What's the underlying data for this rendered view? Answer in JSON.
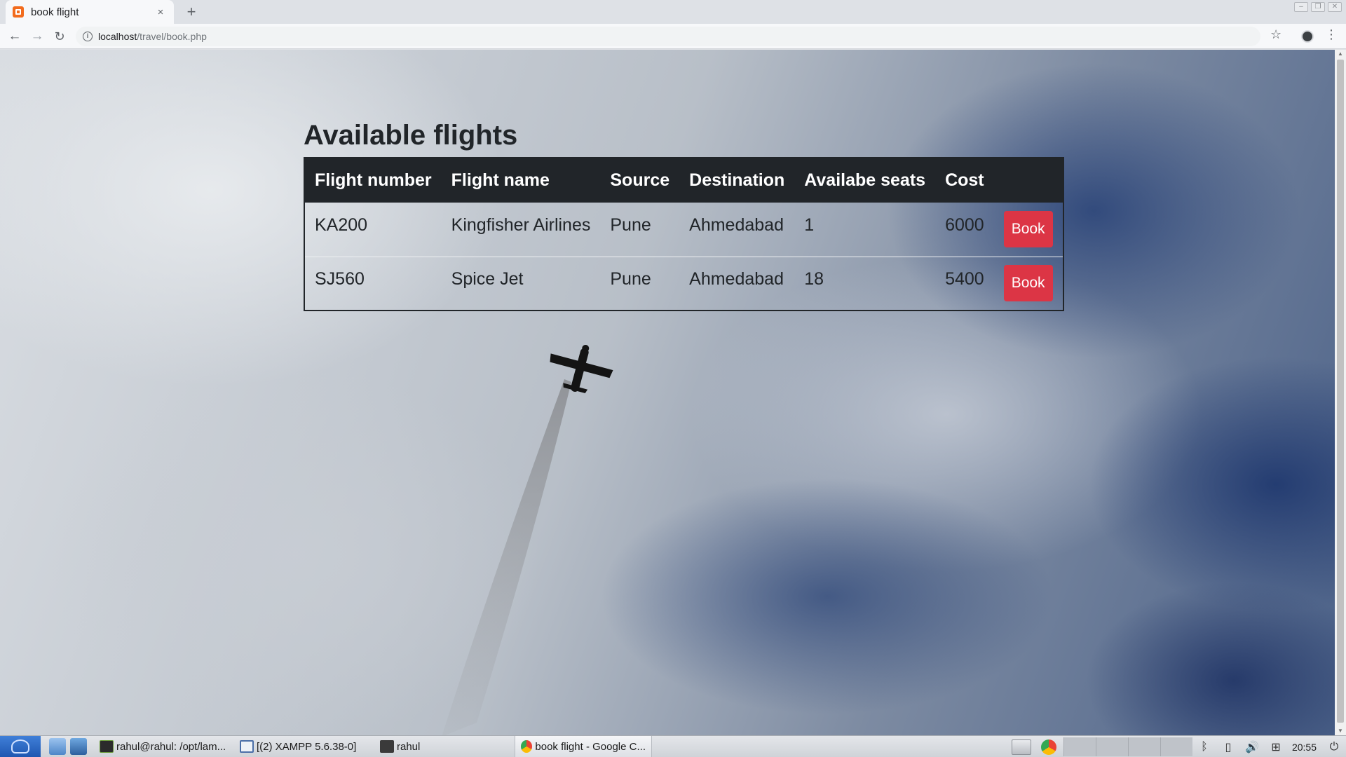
{
  "browser": {
    "tab_title": "book flight",
    "tab_close": "×",
    "new_tab": "+",
    "url_host": "localhost",
    "url_path": "/travel/book.php",
    "icons": [
      "back-icon",
      "forward-icon",
      "reload-icon",
      "info-icon",
      "star-icon",
      "profile-icon",
      "menu-icon"
    ]
  },
  "page": {
    "heading": "Available flights",
    "table": {
      "columns": [
        "Flight number",
        "Flight name",
        "Source",
        "Destination",
        "Availabe seats",
        "Cost"
      ],
      "rows": [
        {
          "flight_number": "KA200",
          "flight_name": "Kingfisher Airlines",
          "source": "Pune",
          "destination": "Ahmedabad",
          "seats": "1",
          "cost": "6000",
          "action": "Book"
        },
        {
          "flight_number": "SJ560",
          "flight_name": "Spice Jet",
          "source": "Pune",
          "destination": "Ahmedabad",
          "seats": "18",
          "cost": "5400",
          "action": "Book"
        }
      ]
    },
    "colors": {
      "header_bg": "#212529",
      "book_button": "#dc3545"
    }
  },
  "taskbar": {
    "items": [
      {
        "label": "rahul@rahul: /opt/lam...",
        "icon": "terminal-icon"
      },
      {
        "label": "[(2) XAMPP 5.6.38-0]",
        "icon": "window-icon"
      },
      {
        "label": "rahul",
        "icon": "folder-icon"
      },
      {
        "label": "book flight - Google C...",
        "icon": "chrome-icon",
        "active": true
      }
    ],
    "clock": "20:55"
  }
}
